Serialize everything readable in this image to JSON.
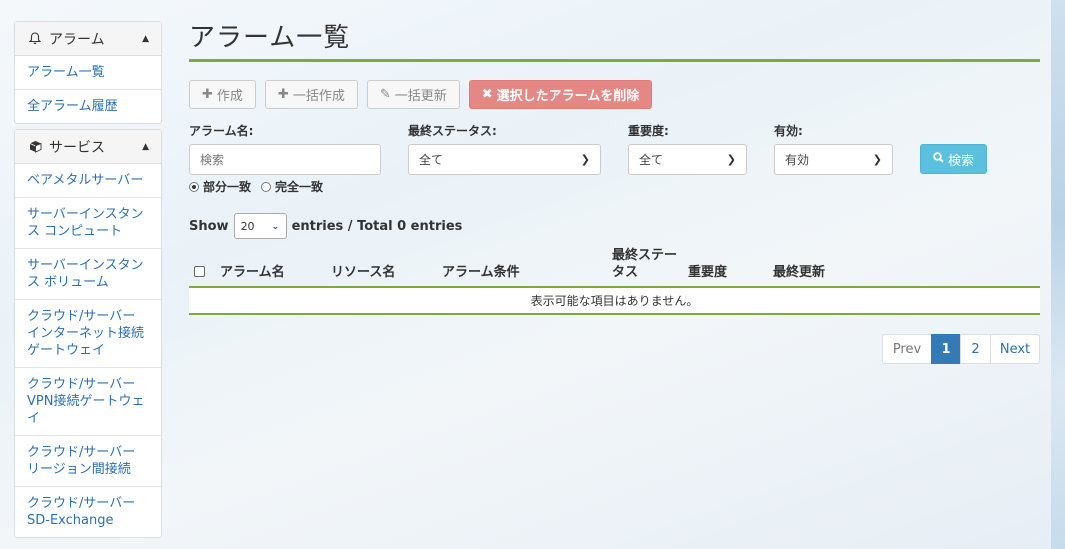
{
  "sidebar": {
    "alarm_panel": {
      "title": "アラーム",
      "icon": "bell-icon",
      "items": [
        {
          "label": "アラーム一覧"
        },
        {
          "label": "全アラーム履歴"
        }
      ]
    },
    "service_panel": {
      "title": "サービス",
      "icon": "cube-icon",
      "items": [
        {
          "label": "ベアメタルサーバー"
        },
        {
          "label": "サーバーインスタンス コンピュート"
        },
        {
          "label": "サーバーインスタンス ボリューム"
        },
        {
          "label": "クラウド/サーバー インターネット接続ゲートウェイ"
        },
        {
          "label": "クラウド/サーバー VPN接続ゲートウェイ"
        },
        {
          "label": "クラウド/サーバー リージョン間接続"
        },
        {
          "label": "クラウド/サーバー SD-Exchange"
        }
      ]
    }
  },
  "main": {
    "title": "アラーム一覧",
    "toolbar": {
      "create": "作成",
      "bulk_create": "一括作成",
      "bulk_update": "一括更新",
      "delete_selected": "選択したアラームを削除"
    },
    "filters": {
      "name_label": "アラーム名:",
      "name_placeholder": "検索",
      "status_label": "最終ステータス:",
      "status_value": "全て",
      "severity_label": "重要度:",
      "severity_value": "全て",
      "enabled_label": "有効:",
      "enabled_value": "有効",
      "search_button": "検索",
      "match_partial": "部分一致",
      "match_exact": "完全一致"
    },
    "entries": {
      "show_label": "Show",
      "page_size": "20",
      "summary": "entries / Total 0 entries"
    },
    "table": {
      "columns": [
        "アラーム名",
        "リソース名",
        "アラーム条件",
        "最終ステータス",
        "重要度",
        "最終更新"
      ],
      "empty_message": "表示可能な項目はありません。"
    },
    "pagination": {
      "prev": "Prev",
      "pages": [
        "1",
        "2"
      ],
      "current": "1",
      "next": "Next"
    }
  },
  "colors": {
    "accent_green": "#7aab3c",
    "link_blue": "#2a6fb0",
    "danger": "#e58785",
    "info": "#5bc0de",
    "primary": "#337ab7"
  }
}
